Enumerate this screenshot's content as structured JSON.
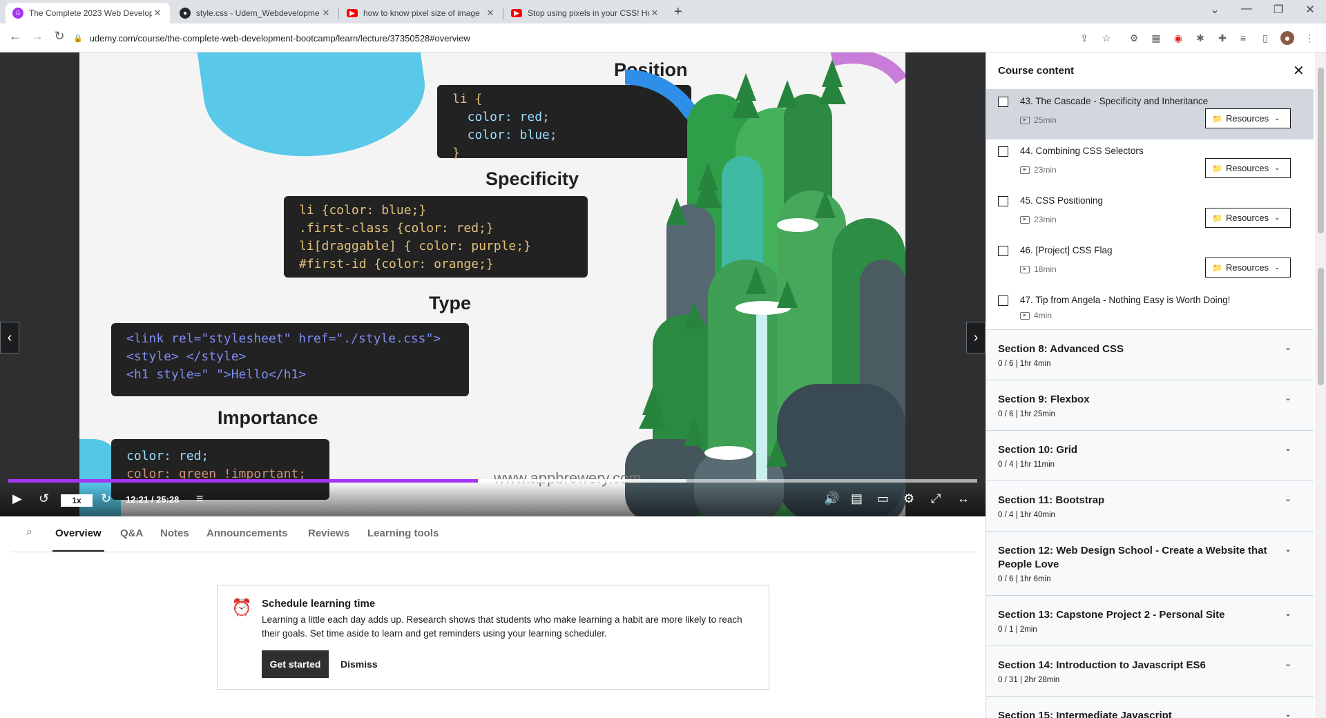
{
  "browser": {
    "tabs": [
      {
        "title": "The Complete 2023 Web Develop",
        "favicon": "udemy-icon"
      },
      {
        "title": "style.css - Udem_Webdevelopme",
        "favicon": "github-icon"
      },
      {
        "title": "how to know pixel size of image",
        "favicon": "youtube-icon"
      },
      {
        "title": "Stop using pixels in your CSS! Ho",
        "favicon": "youtube-icon"
      }
    ],
    "url": "udemy.com/course/the-complete-web-development-bootcamp/learn/lecture/37350528#overview"
  },
  "slide": {
    "headings": {
      "position": "Position",
      "specificity": "Specificity",
      "type": "Type",
      "importance": "Importance"
    },
    "position_code": [
      "li {",
      "  color: red;",
      "  color: blue;",
      "}"
    ],
    "specificity_code": [
      "li {color: blue;}",
      ".first-class {color: red;}",
      "li[draggable] { color: purple;}",
      "#first-id {color: orange;}"
    ],
    "type_code": [
      "<link rel=\"stylesheet\" href=\"./style.css\">",
      "<style> </style>",
      "<h1 style=\" \">Hello</h1>"
    ],
    "importance_code": [
      "color: red;",
      "color: green !important;"
    ],
    "watermark": "www.appbrewery.com"
  },
  "player": {
    "speed": "1x",
    "time": "12:21 / 25:28",
    "progress_fraction": 0.485,
    "buffered_fraction": 0.7
  },
  "lecture_tabs": [
    "Overview",
    "Q&A",
    "Notes",
    "Announcements",
    "Reviews",
    "Learning tools"
  ],
  "schedule": {
    "title": "Schedule learning time",
    "body": "Learning a little each day adds up. Research shows that students who make learning a habit are more likely to reach their goals. Set time aside to learn and get reminders using your learning scheduler.",
    "start": "Get started",
    "dismiss": "Dismiss"
  },
  "sidebar": {
    "title": "Course content",
    "resources_label": "Resources",
    "lectures": [
      {
        "title": "43. The Cascade - Specificity and Inheritance",
        "duration": "25min"
      },
      {
        "title": "44. Combining CSS Selectors",
        "duration": "23min"
      },
      {
        "title": "45. CSS Positioning",
        "duration": "23min"
      },
      {
        "title": "46. [Project] CSS Flag",
        "duration": "18min"
      },
      {
        "title": "47. Tip from Angela - Nothing Easy is Worth Doing!",
        "duration": "4min"
      }
    ],
    "sections": [
      {
        "title": "Section 8: Advanced CSS",
        "sub": "0 / 6 | 1hr 4min"
      },
      {
        "title": "Section 9: Flexbox",
        "sub": "0 / 6 | 1hr 25min"
      },
      {
        "title": "Section 10: Grid",
        "sub": "0 / 4 | 1hr 11min"
      },
      {
        "title": "Section 11: Bootstrap",
        "sub": "0 / 4 | 1hr 40min"
      },
      {
        "title": "Section 12: Web Design School - Create a Website that People Love",
        "sub": "0 / 6 | 1hr 6min"
      },
      {
        "title": "Section 13: Capstone Project 2 - Personal Site",
        "sub": "0 / 1 | 2min"
      },
      {
        "title": "Section 14: Introduction to Javascript ES6",
        "sub": "0 / 31 | 2hr 28min"
      },
      {
        "title": "Section 15: Intermediate Javascript",
        "sub": ""
      }
    ]
  },
  "colors": {
    "accent": "#a435f0",
    "dark": "#2d2f31"
  }
}
